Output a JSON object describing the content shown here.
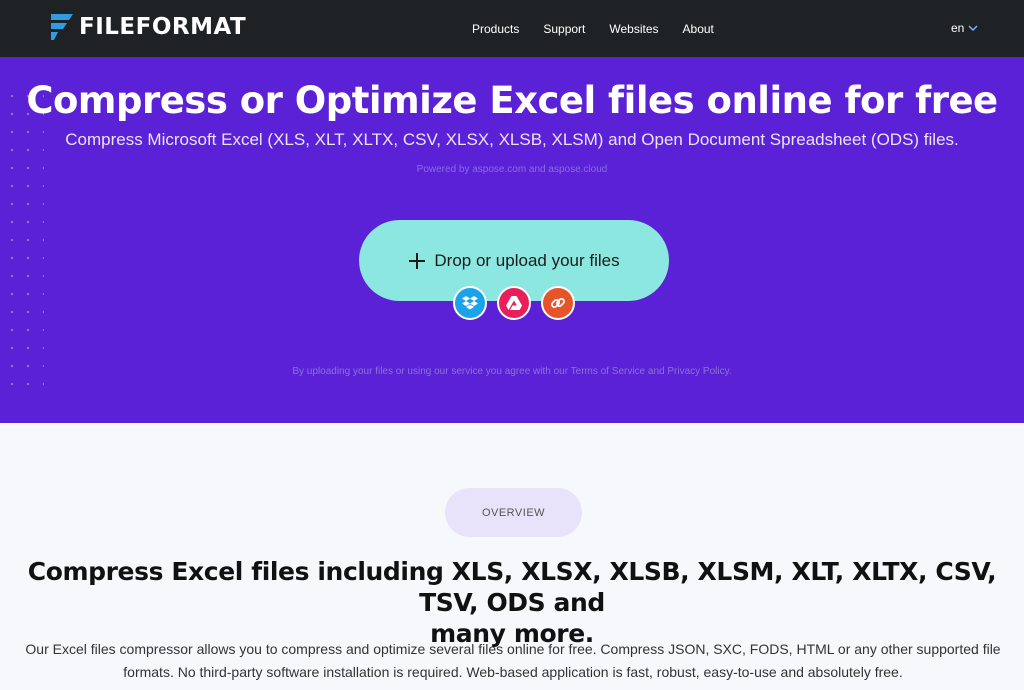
{
  "nav": {
    "logo_text": "FILEFORMAT",
    "items": [
      {
        "label": "Products"
      },
      {
        "label": "Support"
      },
      {
        "label": "Websites"
      },
      {
        "label": "About"
      }
    ],
    "language": "en"
  },
  "hero": {
    "title": "Compress or Optimize Excel files online for free",
    "subtitle": "Compress Microsoft Excel (XLS, XLT, XLTX, CSV, XLSX, XLSB, XLSM) and Open Document Spreadsheet (ODS) files.",
    "powered_by": "Powered by aspose.com and aspose.cloud",
    "upload_label": "Drop or upload your files",
    "sources": [
      {
        "name": "dropbox-icon",
        "color": "#1aa3e8"
      },
      {
        "name": "google-drive-icon",
        "color": "#e81f5a"
      },
      {
        "name": "url-link-icon",
        "color": "#e8542a"
      }
    ],
    "terms": "By uploading your files or using our service you agree with our Terms of Service and Privacy Policy.",
    "background": "#5b21d6",
    "button_color": "#8ce7e1"
  },
  "overview": {
    "badge": "OVERVIEW",
    "title_line1": "Compress Excel files including XLS, XLSX, XLSB, XLSM, XLT, XLTX, CSV, TSV, ODS and",
    "title_line2": "many more.",
    "text_line1": "Our Excel files compressor allows you to compress and optimize several files online for free. Compress JSON, SXC, FODS, HTML or any other supported file",
    "text_line2": "formats. No third-party software installation is required. Web-based application is fast, robust, easy-to-use and absolutely free."
  }
}
